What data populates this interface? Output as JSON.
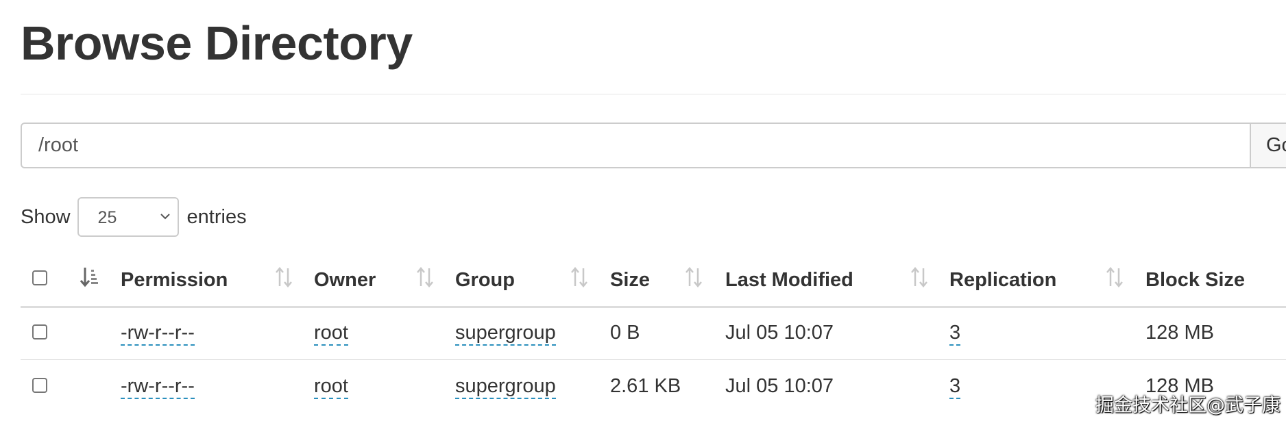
{
  "page": {
    "title": "Browse Directory"
  },
  "path_bar": {
    "value": "/root",
    "go_label": "Go!"
  },
  "entries_length": {
    "prefix": "Show",
    "selected": "25",
    "suffix": "entries"
  },
  "table": {
    "columns": [
      "Permission",
      "Owner",
      "Group",
      "Size",
      "Last Modified",
      "Replication",
      "Block Size"
    ],
    "rows": [
      {
        "permission": "-rw-r--r--",
        "owner": "root",
        "group": "supergroup",
        "size": "0 B",
        "last_modified": "Jul 05 10:07",
        "replication": "3",
        "block_size": "128 MB"
      },
      {
        "permission": "-rw-r--r--",
        "owner": "root",
        "group": "supergroup",
        "size": "2.61 KB",
        "last_modified": "Jul 05 10:07",
        "replication": "3",
        "block_size": "128 MB"
      }
    ]
  },
  "watermark": "掘金技术社区@武子康",
  "icons": {
    "sort_active": "sort-amount-down-icon",
    "sort_inactive": "sort-both-arrows-icon",
    "select_chevron": "chevron-down-icon"
  },
  "colors": {
    "link_underline": "#2a8fbd",
    "text": "#333333",
    "border": "#cccccc"
  }
}
